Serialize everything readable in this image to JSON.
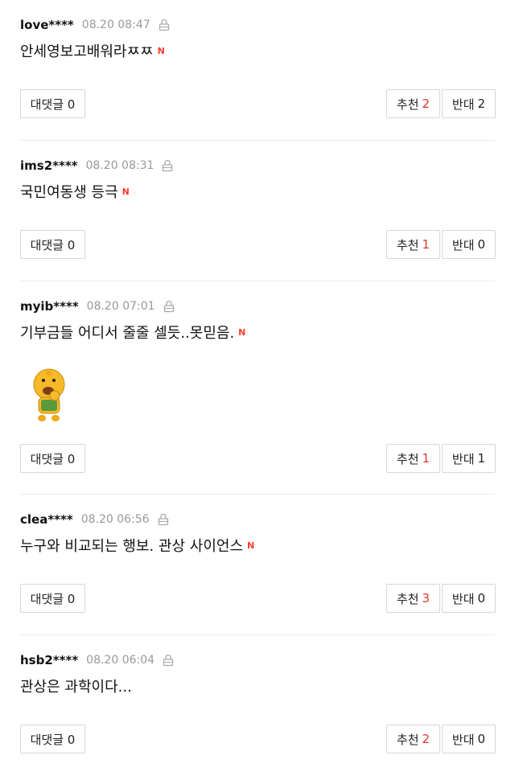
{
  "comments": [
    {
      "author": "love****",
      "time": "08.20 08:47",
      "text": "안세영보고배워라ㅉㅉ",
      "new_badge": "N",
      "has_sticker": false,
      "reply_label": "대댓글 0",
      "recommend_label": "추천",
      "recommend_count": "2",
      "oppose_label": "반대",
      "oppose_count": "2"
    },
    {
      "author": "ims2****",
      "time": "08.20 08:31",
      "text": "국민여동생 등극",
      "new_badge": "N",
      "has_sticker": false,
      "reply_label": "대댓글 0",
      "recommend_label": "추천",
      "recommend_count": "1",
      "oppose_label": "반대",
      "oppose_count": "0"
    },
    {
      "author": "myib****",
      "time": "08.20 07:01",
      "text": "기부금들 어디서 줄줄 셀듯..못믿음.",
      "new_badge": "N",
      "has_sticker": true,
      "sticker_icon": "yellow-character-sticker",
      "reply_label": "대댓글 0",
      "recommend_label": "추천",
      "recommend_count": "1",
      "oppose_label": "반대",
      "oppose_count": "1"
    },
    {
      "author": "clea****",
      "time": "08.20 06:56",
      "text": "누구와 비교되는 행보. 관상 사이언스",
      "new_badge": "N",
      "has_sticker": false,
      "reply_label": "대댓글 0",
      "recommend_label": "추천",
      "recommend_count": "3",
      "oppose_label": "반대",
      "oppose_count": "0"
    },
    {
      "author": "hsb2****",
      "time": "08.20 06:04",
      "text": "관상은 과학이다...",
      "new_badge": "",
      "has_sticker": false,
      "reply_label": "대댓글 0",
      "recommend_label": "추천",
      "recommend_count": "2",
      "oppose_label": "반대",
      "oppose_count": "0"
    }
  ],
  "icons": {
    "lock": "lock-icon",
    "new": "new-badge"
  },
  "colors": {
    "recommend_count": "#e0362b",
    "new_badge": "#ff3b30",
    "time": "#999999",
    "divider": "#ebebeb"
  }
}
